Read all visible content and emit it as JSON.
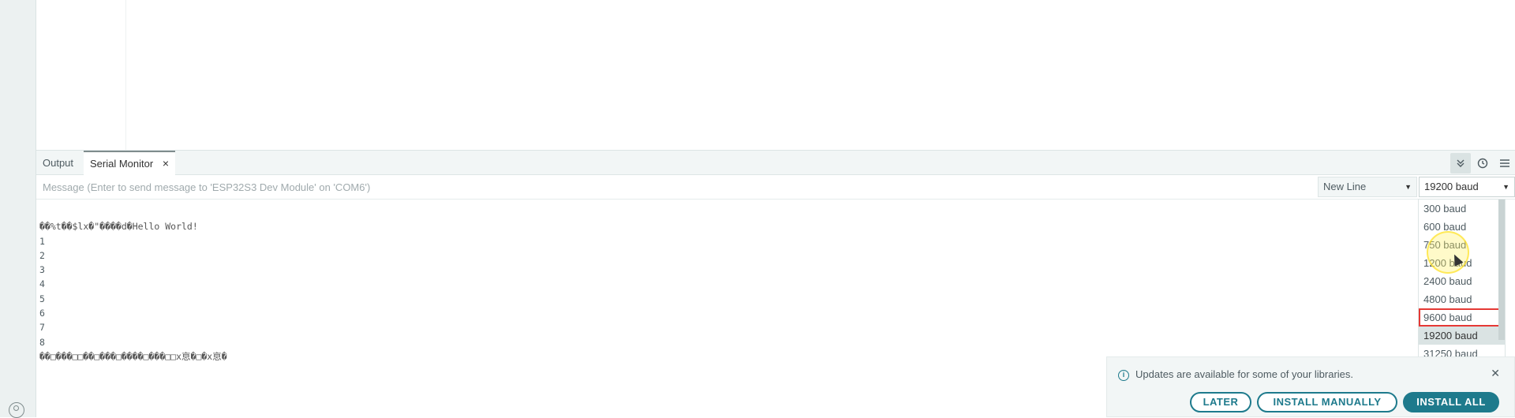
{
  "tabs": {
    "output": "Output",
    "serial_monitor": "Serial Monitor",
    "close_symbol": "×"
  },
  "header_icons": [
    "double-chevron-icon",
    "clock-icon",
    "menu-icon"
  ],
  "message": {
    "placeholder": "Message (Enter to send message to 'ESP32S3 Dev Module' on 'COM6')"
  },
  "line_ending": {
    "selected": "New Line"
  },
  "baud": {
    "selected": "19200 baud"
  },
  "serial_output": {
    "lines": [
      "��%t��$lx�\"����d�Hello World!",
      "1",
      "2",
      "3",
      "4",
      "5",
      "6",
      "7",
      "8",
      "��□���□□��□���□����□���□□x恴�□�x恴�"
    ]
  },
  "baud_options": [
    "300 baud",
    "600 baud",
    "750 baud",
    "1200 baud",
    "2400 baud",
    "4800 baud",
    "9600 baud",
    "19200 baud",
    "31250 baud"
  ],
  "notification": {
    "text": "Updates are available for some of your libraries.",
    "later": "LATER",
    "install_manually": "INSTALL MANUALLY",
    "install_all": "INSTALL ALL"
  },
  "colors": {
    "accent": "#1e7a8c",
    "highlight_box": "#e53935",
    "selected_option_bg": "#dae3e3"
  }
}
